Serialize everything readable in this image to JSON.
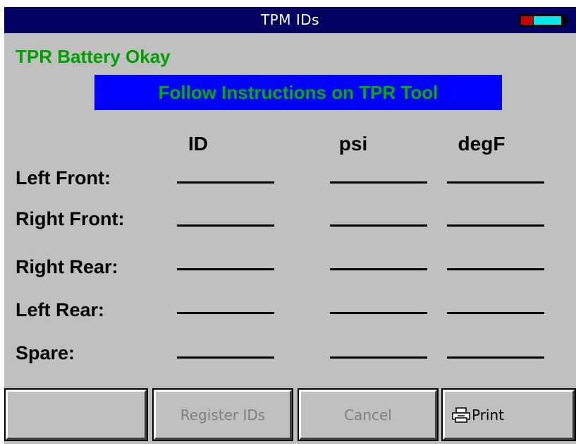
{
  "titlebar": {
    "title": "TPM IDs",
    "battery_icon": "battery-icon",
    "colors": {
      "background": "#000060",
      "battery_low": "#cc0000",
      "battery_charge": "#00e8f0"
    }
  },
  "status": {
    "text": "TPR Battery Okay",
    "color": "#00a000"
  },
  "banner": {
    "text": "Follow Instructions on TPR Tool",
    "background": "#0000ff",
    "color": "#00b000"
  },
  "table": {
    "columns": [
      "ID",
      "psi",
      "degF"
    ],
    "rows": [
      {
        "label": "Left Front:",
        "id": "",
        "psi": "",
        "degF": ""
      },
      {
        "label": "Right Front:",
        "id": "",
        "psi": "",
        "degF": ""
      },
      {
        "label": "Right Rear:",
        "id": "",
        "psi": "",
        "degF": ""
      },
      {
        "label": "Left Rear:",
        "id": "",
        "psi": "",
        "degF": ""
      },
      {
        "label": "Spare:",
        "id": "",
        "psi": "",
        "degF": ""
      }
    ]
  },
  "buttons": {
    "f1": {
      "label": "",
      "enabled": false
    },
    "f2": {
      "label": "Register IDs",
      "enabled": false
    },
    "f3": {
      "label": "Cancel",
      "enabled": false
    },
    "f4": {
      "label": "Print",
      "icon": "printer-icon",
      "enabled": true
    }
  }
}
